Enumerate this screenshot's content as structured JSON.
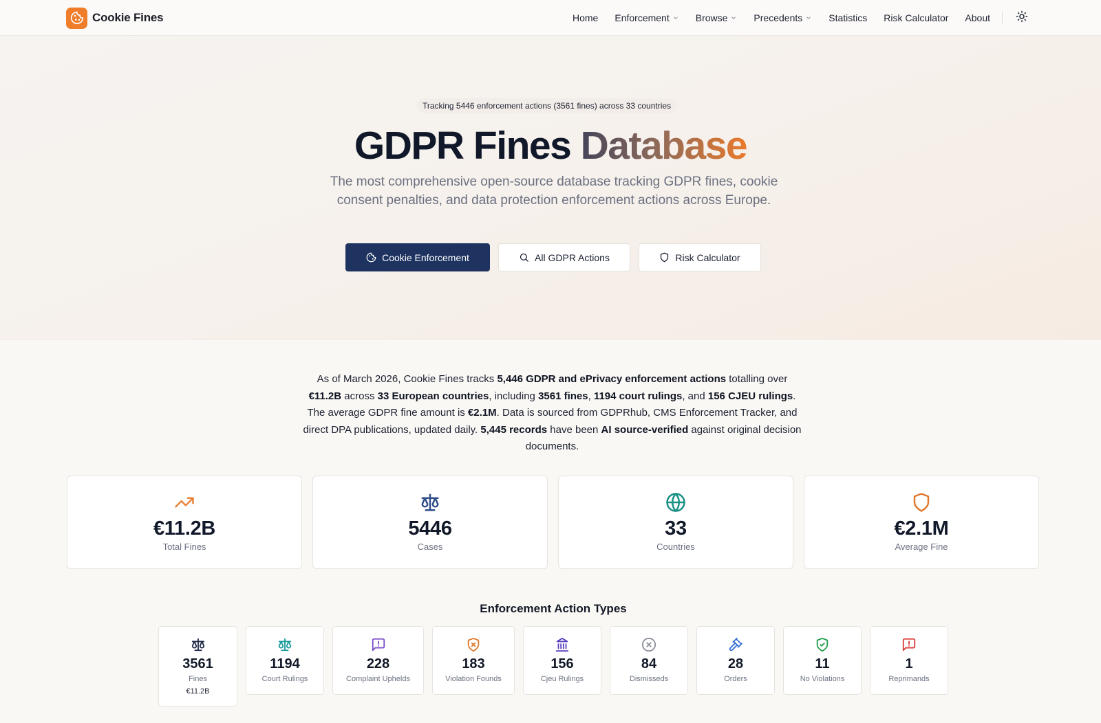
{
  "brand": {
    "name": "Cookie Fines",
    "logo_icon": "cookie-icon",
    "logo_color": "#ef7d2a"
  },
  "nav": {
    "items": [
      {
        "label": "Home",
        "dropdown": false
      },
      {
        "label": "Enforcement",
        "dropdown": true
      },
      {
        "label": "Browse",
        "dropdown": true
      },
      {
        "label": "Precedents",
        "dropdown": true
      },
      {
        "label": "Statistics",
        "dropdown": false
      },
      {
        "label": "Risk Calculator",
        "dropdown": false
      },
      {
        "label": "About",
        "dropdown": false
      }
    ],
    "theme_toggle_icon": "sun-icon"
  },
  "hero": {
    "badge": "Tracking 5446 enforcement actions (3561 fines) across 33 countries",
    "title_main": "GDPR Fines ",
    "title_accent": "Database",
    "subtitle": "The most comprehensive open-source database tracking GDPR fines, cookie consent penalties, and data protection enforcement actions across Europe.",
    "buttons": [
      {
        "label": "Cookie Enforcement",
        "icon": "cookie-icon",
        "style": "primary"
      },
      {
        "label": "All GDPR Actions",
        "icon": "search-icon",
        "style": "secondary"
      },
      {
        "label": "Risk Calculator",
        "icon": "shield-icon",
        "style": "secondary"
      }
    ]
  },
  "summary": {
    "t1": "As of March 2026, Cookie Fines tracks ",
    "b1": "5,446 GDPR and ePrivacy enforcement actions",
    "t2": " totalling over ",
    "b2": "€11.2B",
    "t3": " across ",
    "b3": "33 European countries",
    "t4": ", including ",
    "b4": "3561 fines",
    "t5": ", ",
    "b5": "1194 court rulings",
    "t6": ", and ",
    "b6": "156 CJEU rulings",
    "t7": ". The average GDPR fine amount is ",
    "b7": "€2.1M",
    "t8": ". Data is sourced from GDPRhub, CMS Enforcement Tracker, and direct DPA publications, updated daily. ",
    "b8": "5,445 records",
    "t9": " have been ",
    "b9": "AI source-verified",
    "t10": " against original decision documents."
  },
  "stats": [
    {
      "value": "€11.2B",
      "label": "Total Fines",
      "icon": "trending-up-icon",
      "color": "#e8833a"
    },
    {
      "value": "5446",
      "label": "Cases",
      "icon": "scale-icon",
      "color": "#2f4e8a"
    },
    {
      "value": "33",
      "label": "Countries",
      "icon": "globe-icon",
      "color": "#1a9185"
    },
    {
      "value": "€2.1M",
      "label": "Average Fine",
      "icon": "shield-icon",
      "color": "#e0792f"
    }
  ],
  "types_title": "Enforcement Action Types",
  "types": [
    {
      "value": "3561",
      "label": "Fines",
      "sub": "€11.2B",
      "icon": "scale-icon",
      "color": "#1e2a4a"
    },
    {
      "value": "1194",
      "label": "Court Rulings",
      "icon": "scale-icon",
      "color": "#1a9a9a"
    },
    {
      "value": "228",
      "label": "Complaint Upheld",
      "icon": "message-alert-icon",
      "color": "#7b4fc9"
    },
    {
      "value": "183",
      "label": "Violation Found",
      "icon": "shield-x-icon",
      "color": "#e07b2e"
    },
    {
      "value": "156",
      "label": "Cjeu Rulings",
      "icon": "landmark-icon",
      "color": "#5a3fc0"
    },
    {
      "value": "84",
      "label": "Dismissed",
      "icon": "circle-x-icon",
      "color": "#8a8f9c"
    },
    {
      "value": "28",
      "label": "Orders",
      "icon": "gavel-icon",
      "color": "#3b73d6"
    },
    {
      "value": "11",
      "label": "No Violation",
      "icon": "shield-check-icon",
      "color": "#22a04a"
    },
    {
      "value": "1",
      "label": "Reprimand",
      "icon": "message-alert-icon",
      "color": "#d93b3b"
    }
  ]
}
